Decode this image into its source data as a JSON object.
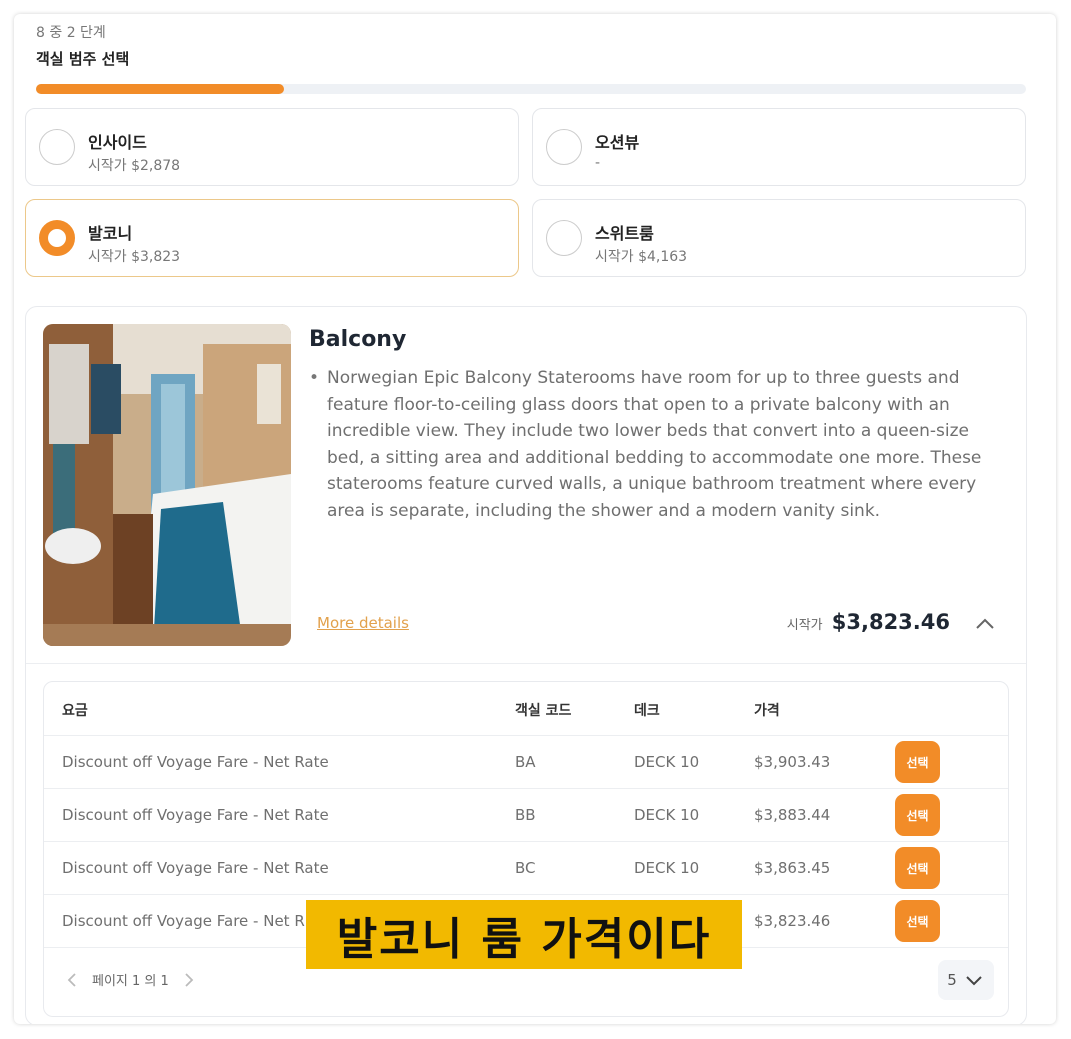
{
  "header": {
    "step_count": "8 중 2 단계",
    "step_title": "객실 범주 선택",
    "progress_fraction": 0.25
  },
  "colors": {
    "accent": "#f28c28",
    "caption_bg": "#f2b900",
    "link": "#e2a14c"
  },
  "categories": [
    {
      "name": "인사이드",
      "price": "시작가 $2,878",
      "selected": false
    },
    {
      "name": "오션뷰",
      "price": "-",
      "selected": false
    },
    {
      "name": "발코니",
      "price": "시작가 $3,823",
      "selected": true
    },
    {
      "name": "스위트룸",
      "price": "시작가 $4,163",
      "selected": false
    }
  ],
  "detail": {
    "title": "Balcony",
    "description": "Norwegian Epic Balcony Staterooms have room for up to three guests and feature floor-to-ceiling glass doors that open to a private balcony with an incredible view. They include two lower beds that convert into a queen-size bed, a sitting area and additional bedding to accommodate one more. These staterooms feature curved walls, a unique bathroom treatment where every area is separate, including the shower and a modern vanity sink.",
    "more_details": "More details",
    "from_label": "시작가",
    "from_price": "$3,823.46",
    "collapse_icon": "chevron-up-icon"
  },
  "rates_table": {
    "headers": {
      "fare": "요금",
      "code": "객실 코드",
      "deck": "데크",
      "price": "가격"
    },
    "rows": [
      {
        "fare": "Discount off Voyage Fare - Net Rate",
        "code": "BA",
        "deck": "DECK 10",
        "price": "$3,903.43",
        "action": "선택"
      },
      {
        "fare": "Discount off Voyage Fare - Net Rate",
        "code": "BB",
        "deck": "DECK 10",
        "price": "$3,883.44",
        "action": "선택"
      },
      {
        "fare": "Discount off Voyage Fare - Net Rate",
        "code": "BC",
        "deck": "DECK 10",
        "price": "$3,863.45",
        "action": "선택"
      },
      {
        "fare": "Discount off Voyage Fare - Net R",
        "code": "",
        "deck": "",
        "price": "$3,823.46",
        "action": "선택"
      }
    ],
    "pager_text": "페이지 1 의 1",
    "page_size": "5"
  },
  "caption": "발코니 룸 가격이다"
}
